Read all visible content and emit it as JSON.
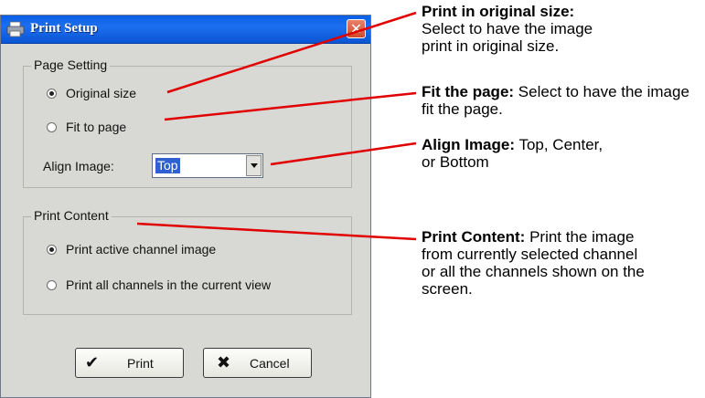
{
  "dialog": {
    "title": "Print Setup",
    "page_setting": {
      "legend": "Page Setting",
      "options": [
        {
          "label": "Original size",
          "checked": true
        },
        {
          "label": "Fit to page",
          "checked": false
        }
      ],
      "align_label": "Align Image:",
      "align_value": "Top"
    },
    "print_content": {
      "legend": "Print Content",
      "options": [
        {
          "label": "Print active channel image",
          "checked": true
        },
        {
          "label": "Print all channels in the current view",
          "checked": false
        }
      ]
    },
    "buttons": {
      "print": "Print",
      "cancel": "Cancel"
    }
  },
  "annotations": [
    {
      "heading": "Print in original size:",
      "body": "Select to have the image print in original size."
    },
    {
      "heading": "Fit the page:",
      "body": "Select to have the image fit the page."
    },
    {
      "heading": "Align Image:",
      "body": "Top, Center, or Bottom"
    },
    {
      "heading": "Print Content:",
      "body": "Print the image from currently selected channel or all the channels shown on the screen."
    }
  ],
  "colors": {
    "title_bar": "#1d6ff0",
    "dialog_bg": "#d8d8d4",
    "callout_line": "#e00000",
    "close_button": "#d04a2a"
  }
}
